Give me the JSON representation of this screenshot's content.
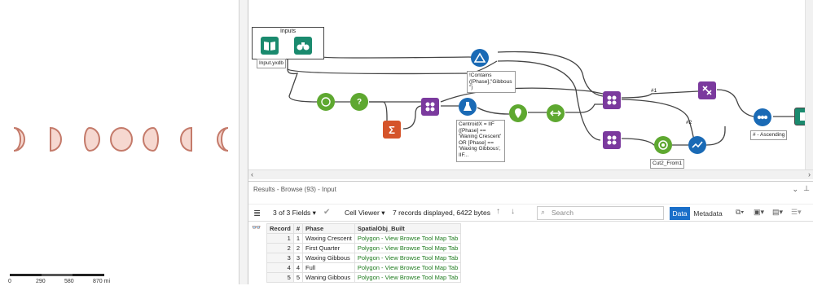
{
  "map": {
    "scale_labels": [
      "0",
      "290",
      "580",
      "870 mi"
    ]
  },
  "canvas": {
    "container_title": "Inputs",
    "input_label": "Input.yxdb",
    "filter_annotation": "!Contains ([Phase],\"Gibbous \")",
    "formula_annotation": "CentroidX = IIF ([Phase] == 'Waning Crescent' OR [Phase] == 'Waxing Gibbous', IIF...",
    "join_label_1": "#1",
    "join_label_2": "#2",
    "cut_label": "Cut2_From1",
    "sort_label": "# - Ascending"
  },
  "results": {
    "title": "Results - Browse (93) - Input",
    "fields_label": "3 of 3 Fields",
    "cell_viewer_label": "Cell Viewer",
    "records_info": "7 records displayed, 6422 bytes",
    "search_placeholder": "Search",
    "data_tab": "Data",
    "metadata_tab": "Metadata",
    "columns": [
      "Record",
      "#",
      "Phase",
      "SpatialObj_Built"
    ],
    "rows": [
      {
        "record": "1",
        "num": "1",
        "phase": "Waxing Crescent",
        "obj": "Polygon - View Browse Tool Map Tab"
      },
      {
        "record": "2",
        "num": "2",
        "phase": "First Quarter",
        "obj": "Polygon - View Browse Tool Map Tab"
      },
      {
        "record": "3",
        "num": "3",
        "phase": "Waxing Gibbous",
        "obj": "Polygon - View Browse Tool Map Tab"
      },
      {
        "record": "4",
        "num": "4",
        "phase": "Full",
        "obj": "Polygon - View Browse Tool Map Tab"
      },
      {
        "record": "5",
        "num": "5",
        "phase": "Waning Gibbous",
        "obj": "Polygon - View Browse Tool Map Tab"
      }
    ]
  },
  "colors": {
    "moon_fill": "#f6d8d0",
    "moon_stroke": "#c47a6a",
    "input_tool": "#1a8a6e",
    "prep_tool": "#5ea830",
    "join_tool": "#7b3a9e",
    "spatial_tool": "#1a6ab5",
    "summarize_tool": "#d5542a",
    "data_tab_bg": "#1a6fc9"
  }
}
